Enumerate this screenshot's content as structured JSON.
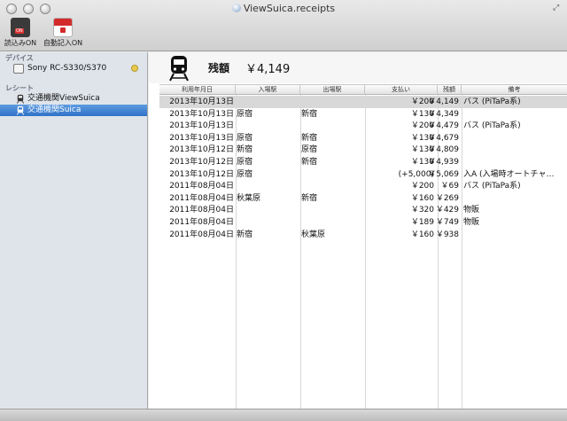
{
  "window": {
    "title": "ViewSuica.receipts"
  },
  "toolbar": {
    "read_on_label": "読込みON",
    "auto_entry_label": "自動記入ON"
  },
  "sidebar": {
    "devices_header": "デバイス",
    "device_name": "Sony RC-S330/S370",
    "receipts_header": "レシート",
    "receipts": [
      {
        "label": "交通機関ViewSuica"
      },
      {
        "label": "交通機関Suica"
      }
    ]
  },
  "main": {
    "balance_label": "残額",
    "balance_value": "￥4,149"
  },
  "table": {
    "headers": {
      "date": "利用年月日",
      "entry": "入場駅",
      "exit": "出場駅",
      "payment": "支払い",
      "balance": "残額",
      "notes": "備考"
    },
    "rows": [
      {
        "date": "2013年10月13日",
        "entry": "",
        "exit": "",
        "payment": "￥200",
        "balance": "￥4,149",
        "notes": "バス (PiTaPa系)"
      },
      {
        "date": "2013年10月13日",
        "entry": "原宿",
        "exit": "新宿",
        "payment": "￥130",
        "balance": "￥4,349",
        "notes": ""
      },
      {
        "date": "2013年10月13日",
        "entry": "",
        "exit": "",
        "payment": "￥200",
        "balance": "￥4,479",
        "notes": "バス (PiTaPa系)"
      },
      {
        "date": "2013年10月13日",
        "entry": "原宿",
        "exit": "新宿",
        "payment": "￥130",
        "balance": "￥4,679",
        "notes": ""
      },
      {
        "date": "2013年10月12日",
        "entry": "新宿",
        "exit": "原宿",
        "payment": "￥130",
        "balance": "￥4,809",
        "notes": ""
      },
      {
        "date": "2013年10月12日",
        "entry": "原宿",
        "exit": "新宿",
        "payment": "￥130",
        "balance": "￥4,939",
        "notes": ""
      },
      {
        "date": "2013年10月12日",
        "entry": "原宿",
        "exit": "",
        "payment": "(+5,000)",
        "balance": "￥5,069",
        "notes": "入A (入場時オートチャ…"
      },
      {
        "date": "2011年08月04日",
        "entry": "",
        "exit": "",
        "payment": "￥200",
        "balance": "￥69",
        "notes": "バス (PiTaPa系)"
      },
      {
        "date": "2011年08月04日",
        "entry": "秋葉原",
        "exit": "新宿",
        "payment": "￥160",
        "balance": "￥269",
        "notes": ""
      },
      {
        "date": "2011年08月04日",
        "entry": "",
        "exit": "",
        "payment": "￥320",
        "balance": "￥429",
        "notes": "物販"
      },
      {
        "date": "2011年08月04日",
        "entry": "",
        "exit": "",
        "payment": "￥189",
        "balance": "￥749",
        "notes": "物販"
      },
      {
        "date": "2011年08月04日",
        "entry": "新宿",
        "exit": "秋葉原",
        "payment": "￥160",
        "balance": "￥938",
        "notes": ""
      }
    ]
  }
}
